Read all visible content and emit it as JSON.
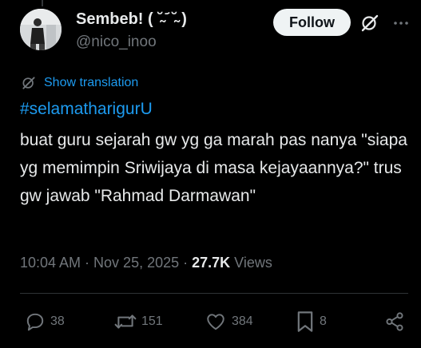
{
  "post": {
    "author": {
      "display_name": "Sembeb! ( ˘̴ ᷄ ˘̴ )",
      "handle": "@nico_inoo"
    },
    "follow_label": "Follow",
    "translate_label": "Show translation",
    "hashtag": "#selamatharigurU",
    "text": "buat guru sejarah gw yg ga marah pas nanya \"siapa yg memimpin Sriwijaya di masa kejayaannya?\" trus gw jawab \"Rahmad Darmawan\"",
    "timestamp": "10:04 AM · Nov 25, 2025 · ",
    "views_count": "27.7K",
    "views_label": " Views"
  },
  "actions": {
    "replies": "38",
    "reposts": "151",
    "likes": "384",
    "bookmarks": "8"
  },
  "icons": {
    "reply": "reply-icon",
    "repost": "repost-icon",
    "like": "heart-icon",
    "bookmark": "bookmark-icon",
    "share": "share-icon",
    "grok": "grok-icon",
    "more": "more-icon",
    "translate": "translate-icon"
  },
  "colors": {
    "background": "#000000",
    "text": "#e7e9ea",
    "secondary": "#71767b",
    "accent": "#1d9bf0",
    "follow_bg": "#eff3f4"
  }
}
